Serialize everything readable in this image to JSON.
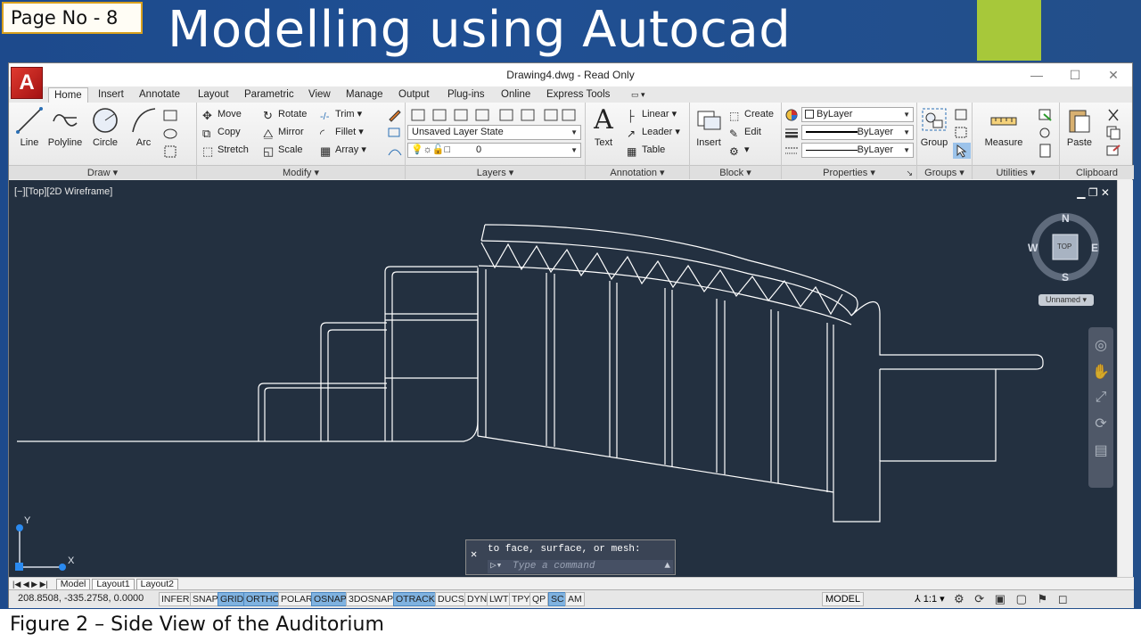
{
  "slide": {
    "page_no": "Page No - 8",
    "title": "Modelling using Autocad",
    "caption": "Figure 2 – Side View of the Auditorium",
    "accent_color": "#a7c83a",
    "background_color": "#1f4f93"
  },
  "window": {
    "title": "Drawing4.dwg - Read Only",
    "app_logo": "A",
    "controls": [
      "—",
      "☐",
      "✕"
    ]
  },
  "ribbon_tabs": [
    "Home",
    "Insert",
    "Annotate",
    "Layout",
    "Parametric",
    "View",
    "Manage",
    "Output",
    "Plug-ins",
    "Online",
    "Express Tools"
  ],
  "active_tab": "Home",
  "panels": {
    "draw": {
      "title": "Draw ▾",
      "line": "Line",
      "polyline": "Polyline",
      "circle": "Circle",
      "arc": "Arc"
    },
    "modify": {
      "title": "Modify ▾",
      "move": "Move",
      "rotate": "Rotate",
      "trim": "Trim",
      "copy": "Copy",
      "mirror": "Mirror",
      "fillet": "Fillet",
      "stretch": "Stretch",
      "scale": "Scale",
      "array": "Array"
    },
    "layers": {
      "title": "Layers ▾",
      "layer_state": "Unsaved Layer State",
      "current_layer": "0"
    },
    "annotation": {
      "title": "Annotation ▾",
      "text": "Text",
      "linear": "Linear",
      "leader": "Leader",
      "table": "Table"
    },
    "block": {
      "title": "Block ▾",
      "insert": "Insert",
      "create": "Create",
      "edit": "Edit"
    },
    "properties": {
      "title": "Properties ▾",
      "color": "ByLayer",
      "lineweight": "ByLayer",
      "linetype": "ByLayer"
    },
    "groups": {
      "title": "Groups ▾",
      "group": "Group"
    },
    "utilities": {
      "title": "Utilities ▾",
      "measure": "Measure"
    },
    "clipboard": {
      "title": "Clipboard",
      "paste": "Paste"
    }
  },
  "viewport": {
    "label": "[−][Top][2D Wireframe]",
    "controls": "▁ ❐ ✕",
    "background": "#233040",
    "viewcube": {
      "n": "N",
      "s": "S",
      "e": "E",
      "w": "W",
      "top": "TOP",
      "ucs_name": "Unnamed ▾"
    },
    "ucs": {
      "x": "X",
      "y": "Y"
    }
  },
  "command": {
    "history": "to face, surface, or mesh:",
    "placeholder": "Type a command"
  },
  "layout_tabs": [
    "Model",
    "Layout1",
    "Layout2"
  ],
  "status": {
    "coords": "208.8508, -335.2758, 0.0000",
    "toggles": [
      {
        "label": "INFER",
        "on": false
      },
      {
        "label": "SNAP",
        "on": false
      },
      {
        "label": "GRID",
        "on": true
      },
      {
        "label": "ORTHO",
        "on": true
      },
      {
        "label": "POLAR",
        "on": false
      },
      {
        "label": "OSNAP",
        "on": true
      },
      {
        "label": "3DOSNAP",
        "on": false
      },
      {
        "label": "OTRACK",
        "on": true
      },
      {
        "label": "DUCS",
        "on": false
      },
      {
        "label": "DYN",
        "on": false
      },
      {
        "label": "LWT",
        "on": false
      },
      {
        "label": "TPY",
        "on": false
      },
      {
        "label": "QP",
        "on": false
      },
      {
        "label": "SC",
        "on": true
      },
      {
        "label": "AM",
        "on": false
      }
    ],
    "model": "MODEL",
    "scale": "1:1 ▾"
  }
}
